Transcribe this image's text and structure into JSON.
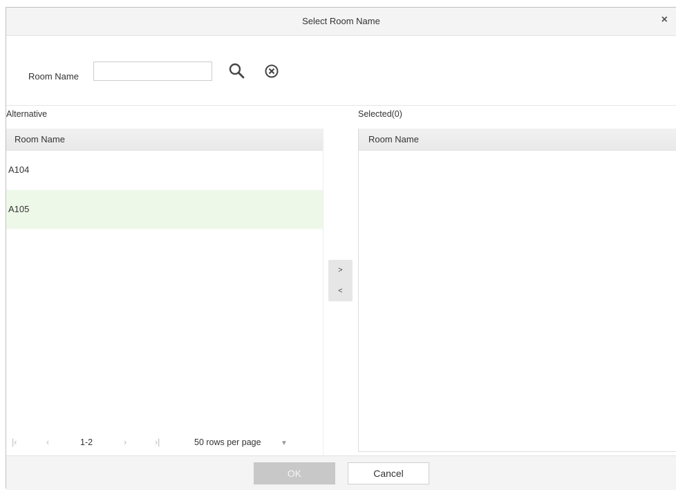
{
  "dialog": {
    "title": "Select Room Name",
    "close_glyph": "×"
  },
  "search": {
    "label": "Room Name",
    "value": "",
    "placeholder": "",
    "search_icon": "search-icon",
    "clear_icon": "clear-circle-icon"
  },
  "left_panel": {
    "header": "Alternative",
    "column": "Room Name",
    "rows": [
      "A104",
      "A105"
    ]
  },
  "right_panel": {
    "header": "Selected(0)",
    "column": "Room Name",
    "rows": []
  },
  "transfer": {
    "move_right": ">",
    "move_left": "<"
  },
  "pager": {
    "first": "|‹",
    "prev": "‹",
    "range": "1-2",
    "next": "›",
    "last": "›|",
    "page_size": "50 rows per page",
    "dropdown_glyph": "▼"
  },
  "footer": {
    "ok_label": "OK",
    "cancel_label": "Cancel"
  },
  "colors": {
    "hover_row": "#eef8e9",
    "disabled_button": "#c8c8c8"
  }
}
